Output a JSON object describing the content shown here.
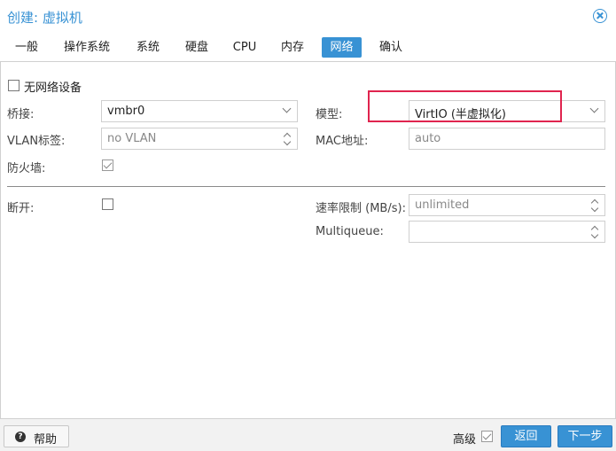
{
  "window": {
    "title": "创建: 虚拟机"
  },
  "tabs": [
    {
      "label": "一般"
    },
    {
      "label": "操作系统"
    },
    {
      "label": "系统"
    },
    {
      "label": "硬盘"
    },
    {
      "label": "CPU"
    },
    {
      "label": "内存"
    },
    {
      "label": "网络",
      "active": true
    },
    {
      "label": "确认"
    }
  ],
  "form": {
    "no_network_label": "无网络设备",
    "no_network_checked": false,
    "bridge_label": "桥接:",
    "bridge_value": "vmbr0",
    "vlan_label": "VLAN标签:",
    "vlan_value": "no VLAN",
    "firewall_label": "防火墙:",
    "firewall_checked": true,
    "model_label": "模型:",
    "model_value": "VirtIO (半虚拟化)",
    "mac_label": "MAC地址:",
    "mac_value": "auto",
    "disconnect_label": "断开:",
    "disconnect_checked": false,
    "rate_limit_label": "速率限制 (MB/s):",
    "rate_limit_value": "unlimited",
    "multiqueue_label": "Multiqueue:",
    "multiqueue_value": ""
  },
  "footer": {
    "help_label": "帮助",
    "advanced_label": "高级",
    "advanced_checked": true,
    "back_label": "返回",
    "next_label": "下一步"
  },
  "colors": {
    "accent": "#3892d4",
    "highlight_box": "#e0244e"
  },
  "icons": {
    "close": "close-circle-icon",
    "help": "question-circle-icon"
  }
}
